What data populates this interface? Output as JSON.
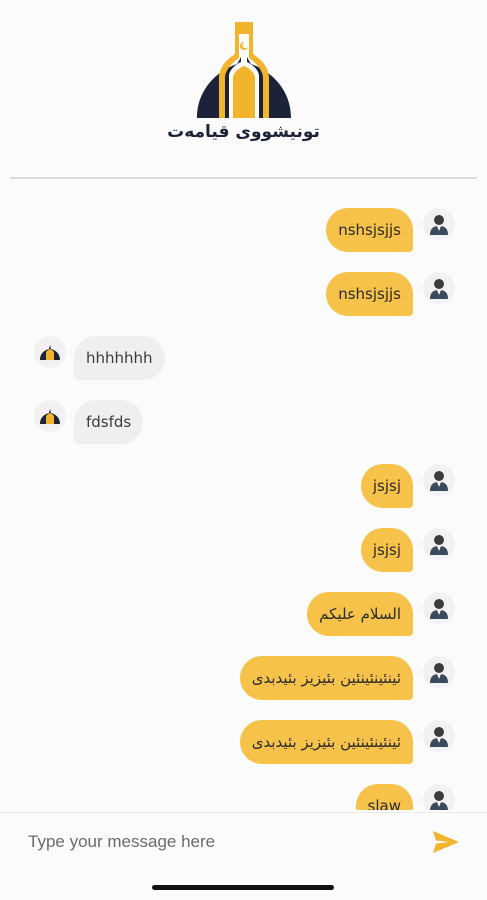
{
  "header": {
    "brand_text": "تونیشووی قیامەت",
    "colors": {
      "navy": "#1c2238",
      "gold": "#f2b32d"
    }
  },
  "messages": [
    {
      "sender": "user",
      "text": "nshsjsjjs",
      "icon": "user-avatar-icon"
    },
    {
      "sender": "user",
      "text": "nshsjsjjs",
      "icon": "user-avatar-icon"
    },
    {
      "sender": "bot",
      "text": "hhhhhhh",
      "icon": "mosque-logo-icon"
    },
    {
      "sender": "bot",
      "text": "fdsfds",
      "icon": "mosque-logo-icon"
    },
    {
      "sender": "user",
      "text": "jsjsj",
      "icon": "user-avatar-icon"
    },
    {
      "sender": "user",
      "text": "jsjsj",
      "icon": "user-avatar-icon"
    },
    {
      "sender": "user",
      "text": "السلام عليكم",
      "icon": "user-avatar-icon"
    },
    {
      "sender": "user",
      "text": "ئینئینئینئین بئیزیز بئیدبدی",
      "icon": "user-avatar-icon"
    },
    {
      "sender": "user",
      "text": "ئینئینئینئین بئیزیز بئیدبدی",
      "icon": "user-avatar-icon"
    },
    {
      "sender": "user",
      "text": "slaw",
      "icon": "user-avatar-icon"
    }
  ],
  "composer": {
    "placeholder": "Type your message here",
    "send_icon": "send-icon",
    "accent": "#f2b32d"
  }
}
